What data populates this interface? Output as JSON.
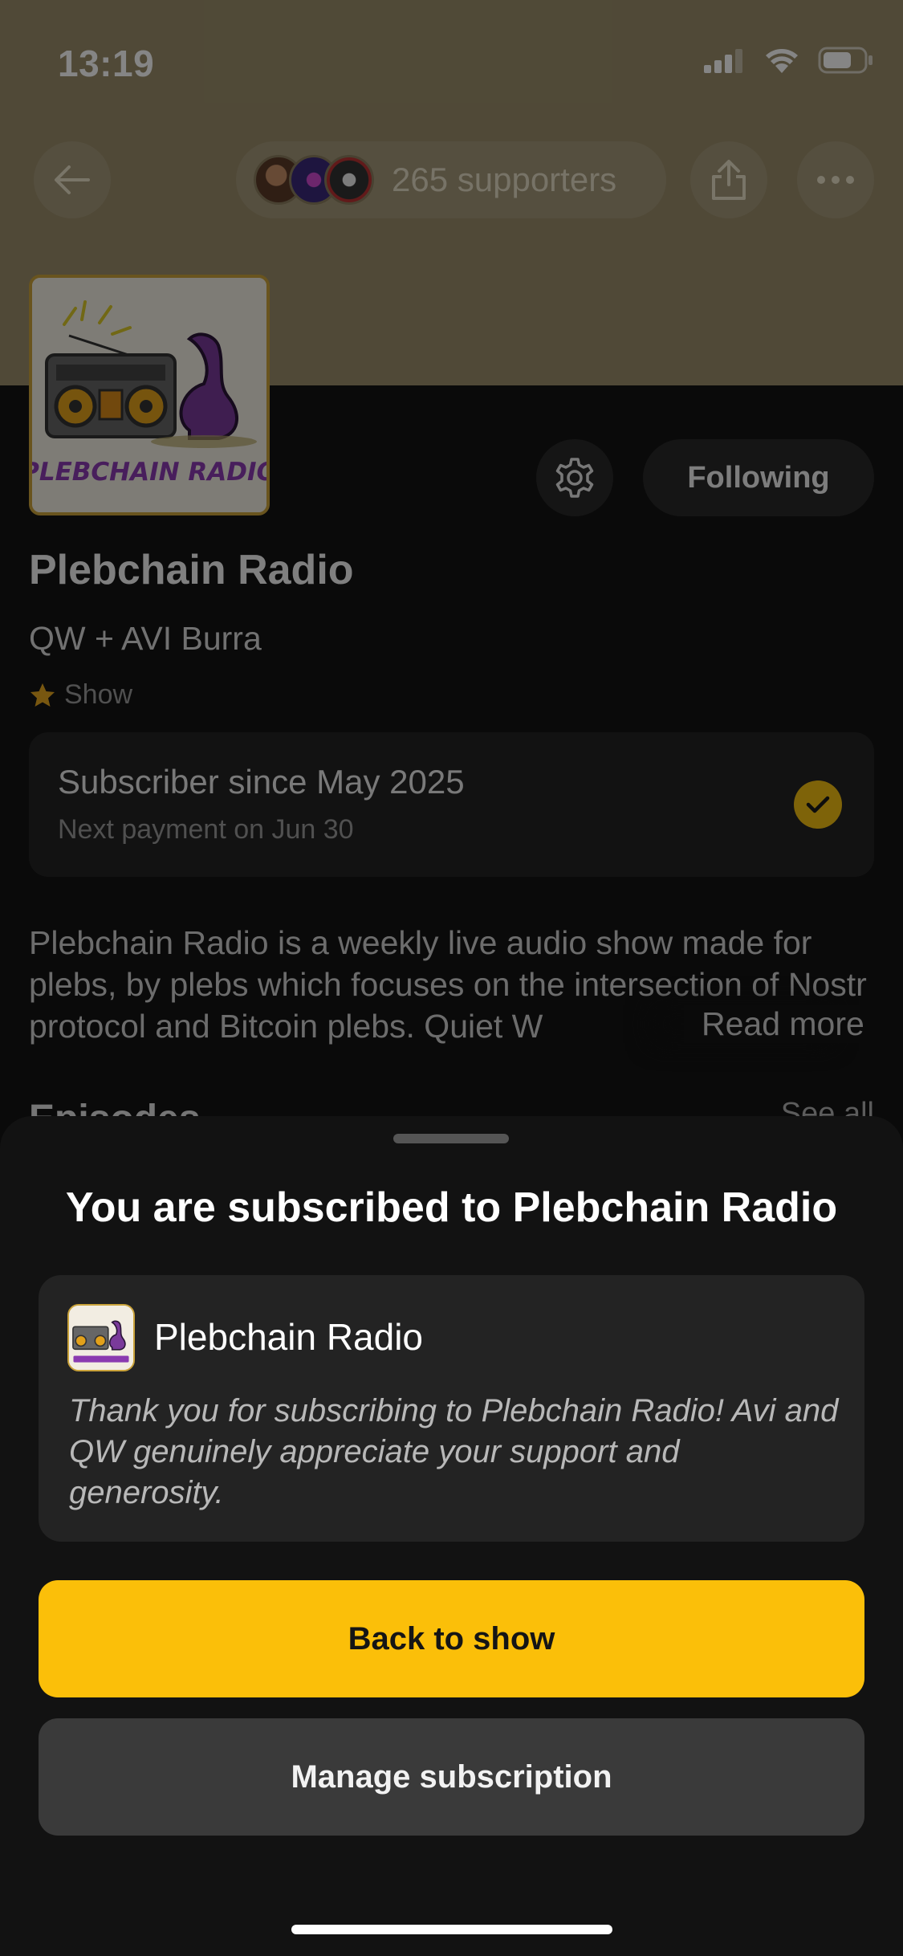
{
  "status_bar": {
    "time": "13:19"
  },
  "header": {
    "supporters_label": "265 supporters"
  },
  "show": {
    "title": "Plebchain Radio",
    "hosts": "QW + AVI Burra",
    "type": "Show",
    "cover_text": "PLEBCHAIN RADIO",
    "following_label": "Following"
  },
  "subscription": {
    "since": "Subscriber since May 2025",
    "next_payment": "Next payment on Jun 30"
  },
  "description": {
    "text": "Plebchain Radio is a weekly live audio show made for plebs, by plebs which focuses on the intersection of Nostr protocol and Bitcoin plebs. Quiet W",
    "read_more": "Read more"
  },
  "section_peek": {
    "title": "Episodes",
    "see_all": "See all"
  },
  "sheet": {
    "title": "You are  subscribed to Plebchain Radio",
    "card_name": "Plebchain Radio",
    "card_message": "Thank you for subscribing to Plebchain Radio! Avi and QW genuinely appreciate your support and generosity.",
    "primary_button": "Back to show",
    "secondary_button": "Manage subscription"
  },
  "colors": {
    "accent": "#fbbf09",
    "sheet_background": "#121212",
    "card_background": "#232323"
  }
}
